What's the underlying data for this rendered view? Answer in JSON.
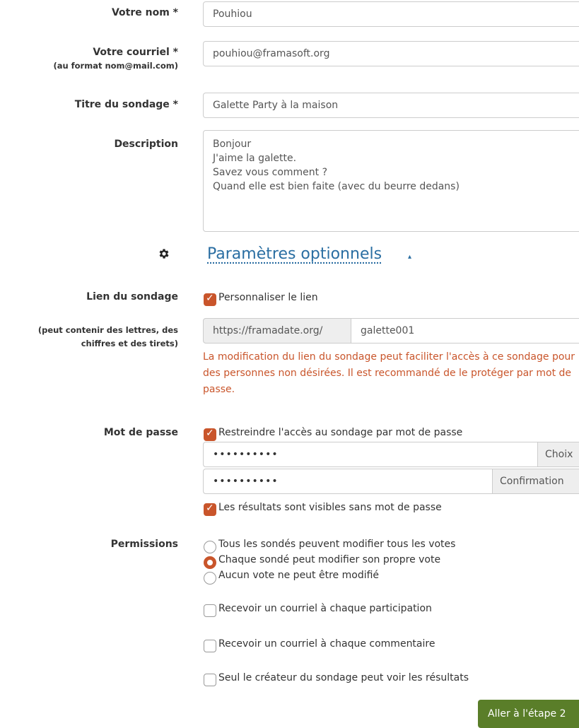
{
  "form": {
    "name": {
      "label": "Votre nom *",
      "value": "Pouhiou"
    },
    "email": {
      "label": "Votre courriel *",
      "hint": "(au format nom@mail.com)",
      "value": "pouhiou@framasoft.org"
    },
    "title": {
      "label": "Titre du sondage *",
      "value": "Galette Party à la maison"
    },
    "description": {
      "label": "Description",
      "lines": [
        "Bonjour",
        "J'aime la galette.",
        "Savez vous comment ?",
        "Quand elle est bien faite (avec du beurre dedans)"
      ]
    }
  },
  "optional": {
    "heading": "Paramètres optionnels",
    "caret": "▴",
    "icon": "gear-icon"
  },
  "link": {
    "label": "Lien du sondage",
    "hint_line1": "(peut contenir des lettres, des",
    "hint_line2": "chiffres et des tirets)",
    "customize_label": "Personnaliser le lien",
    "customize_checked": true,
    "prefix": "https://framadate.org/",
    "value": "galette001",
    "warning": "La modification du lien du sondage peut faciliter l'accès à ce sondage pour des personnes non désirées. Il est recommandé de le protéger par mot de passe."
  },
  "password": {
    "label": "Mot de passe",
    "restrict_label": "Restreindre l'accès au sondage par mot de passe",
    "restrict_checked": true,
    "value": "••••••••••",
    "choice_addon": "Choix",
    "confirm_value": "••••••••••",
    "confirm_addon": "Confirmation",
    "results_visible_label": "Les résultats sont visibles sans mot de passe",
    "results_visible_checked": true
  },
  "permissions": {
    "label": "Permissions",
    "options": [
      {
        "label": "Tous les sondés peuvent modifier tous les votes",
        "selected": false
      },
      {
        "label": "Chaque sondé peut modifier son propre vote",
        "selected": true
      },
      {
        "label": "Aucun vote ne peut être modifié",
        "selected": false
      }
    ]
  },
  "notifications": {
    "participation": "Recevoir un courriel à chaque participation",
    "comment": "Recevoir un courriel à chaque commentaire",
    "creator_only": "Seul le créateur du sondage peut voir les résultats"
  },
  "actions": {
    "next": "Aller à l'étape 2"
  },
  "colors": {
    "accent": "#c9552b",
    "link": "#2a6ea2",
    "button": "#5a7e29"
  }
}
